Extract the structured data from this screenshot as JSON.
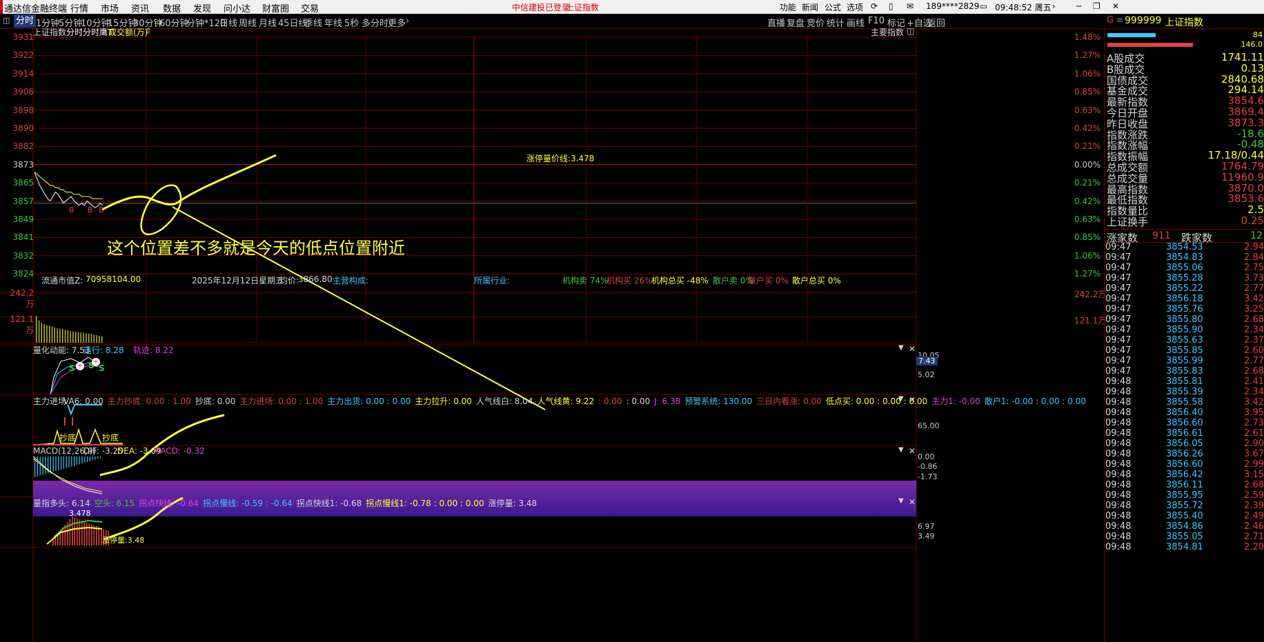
{
  "menubar": {
    "app_title": "通达信金融终端",
    "menus": [
      "行情",
      "市场",
      "资讯",
      "数据",
      "发现",
      "问小达",
      "财富圈",
      "交易"
    ],
    "login_status": "中信建投已登录",
    "index_name": "上证指数",
    "right_items": [
      "功能",
      "新闻",
      "公式",
      "选项"
    ],
    "account": "189****2829",
    "clock": "09:48:52 周五"
  },
  "tabs": {
    "items": [
      "分时",
      "1分钟",
      "5分钟",
      "10分钟",
      "15分钟",
      "30分钟",
      "60分钟",
      "分钟*120",
      "日线",
      "周线",
      "月线",
      "45日线",
      "季线",
      "年线",
      "5秒",
      "多分时",
      "更多"
    ],
    "active": "分时",
    "right": [
      "直播",
      "复盘",
      "竞价",
      "统计",
      "画线",
      "F10",
      "标记",
      "+自选",
      "返回"
    ]
  },
  "chart_header": {
    "title": "上证指数",
    "mode1": "分时",
    "mode2": "分时鹰T",
    "mode3": "成交额(万)",
    "main_indicator": "主要指数"
  },
  "chart_data": {
    "type": "line",
    "y_labels": [
      "3931",
      "3922",
      "3914",
      "3906",
      "3898",
      "3890",
      "3882",
      "3873",
      "3865",
      "3857",
      "3849",
      "3841",
      "3832",
      "3824"
    ],
    "pct_labels": [
      "1.48%",
      "1.27%",
      "1.06%",
      "0.85%",
      "0.63%",
      "0.42%",
      "0.21%",
      "0.00%",
      "0.21%",
      "0.42%",
      "0.63%",
      "0.85%",
      "1.06%",
      "1.27%"
    ],
    "ylim": [
      3824,
      3931
    ],
    "prev_close": 3873.3,
    "price_series": [
      3870,
      3867,
      3864,
      3862,
      3860,
      3858,
      3857,
      3859,
      3861,
      3860,
      3858,
      3856,
      3857,
      3858,
      3859,
      3857,
      3856,
      3855,
      3856,
      3855,
      3857,
      3856,
      3855,
      3854,
      3854.5,
      3856,
      3855
    ],
    "avg_series": [
      3870,
      3869,
      3868,
      3867,
      3866,
      3865,
      3864,
      3864,
      3863,
      3863,
      3862,
      3862,
      3861,
      3861,
      3861,
      3860,
      3860,
      3860,
      3859,
      3859,
      3859,
      3859,
      3858,
      3858,
      3858,
      3858,
      3858
    ],
    "volume_labels": [
      "242.2万",
      "121.1万"
    ],
    "volume_bars": [
      230,
      190,
      170,
      160,
      150,
      145,
      140,
      130,
      125,
      120,
      118,
      110,
      108,
      100,
      95,
      92,
      90,
      88,
      85,
      80,
      78,
      75,
      70,
      65,
      60,
      55
    ],
    "limit_line_label": "涨停量价线:3.478"
  },
  "info_bar": {
    "mcap_label": "流通市值Z:",
    "mcap_value": "70958104.00",
    "date": "2025年12月12日星期五",
    "avg_label": "均价:",
    "avg_value": "3866.80",
    "main_label": "主营构成:",
    "industry_label": "所属行业:",
    "inst_sell": "机构卖 74%",
    "inst_buy": "机构买 26%",
    "inst_total": "机构总买 -48%",
    "retail_sell": "散户卖 0%",
    "retail_buy": "散户买 0%",
    "retail_total": "散户总买 0%"
  },
  "annotation_text": "这个位置差不多就是今天的低点位置附近",
  "panel1": {
    "name": "量化",
    "a": "动能: 7.53",
    "b": "运行: 8.28",
    "c": "轨迹: 8.22",
    "r1": "10.05",
    "r2": "7.43",
    "r3": "5.02"
  },
  "panel2": {
    "name": "主力进场",
    "items": [
      {
        "t": "VA6: 0.00",
        "c": "#d8d8d8"
      },
      {
        "t": "主力抄底: 0.00 : 1.00",
        "c": "#e04040"
      },
      {
        "t": "抄底: 0.00",
        "c": "#d8d8d8"
      },
      {
        "t": "主力进场: 0.00 : 1.00",
        "c": "#e04040"
      },
      {
        "t": "主力出货: 0.00 : 0.00",
        "c": "#3cc8ff"
      },
      {
        "t": "主力拉升: 0.00",
        "c": "#ffff40"
      },
      {
        "t": "人气线白: 8.04",
        "c": "#d8d8d8"
      },
      {
        "t": "人气线黄: 9.22",
        "c": "#ffff40"
      },
      {
        "t": ": 0.00",
        "c": "#e04040"
      },
      {
        "t": ": 0.00",
        "c": "#d8d8d8"
      },
      {
        "t": "J: 6.38",
        "c": "#e040e0"
      },
      {
        "t": "预警系统: 130.00",
        "c": "#3cc8ff"
      },
      {
        "t": "三日内看涨: 0.00",
        "c": "#e04040"
      },
      {
        "t": "低点买: 0.00 : 0.00 : 0.00",
        "c": "#ffff40"
      },
      {
        "t": "主力1: -0.00",
        "c": "#e040e0"
      },
      {
        "t": "散户1: -0.00 : 0.00 : 0.00",
        "c": "#3cc8ff"
      }
    ],
    "r1": "65.00",
    "tag": "抄底"
  },
  "panel3": {
    "name": "MACD(12,26,9)",
    "dif": "DIF: -3.25",
    "dea": "DEA: -3.09",
    "macd": "MACD: -0.32",
    "r1": "0.00",
    "r2": "-0.86",
    "r3": "-1.73"
  },
  "panel4": {
    "name": "量指",
    "items": [
      {
        "t": "多头: 6.14",
        "c": "#d8d8d8"
      },
      {
        "t": "空头: 6.15",
        "c": "#3cc83c"
      },
      {
        "t": "拐点快线: -0.64",
        "c": "#e040e0"
      },
      {
        "t": "拐点慢线: -0.59 : -0.64",
        "c": "#3cc8ff"
      },
      {
        "t": "拐点快线1: -0.68",
        "c": "#d8d8d8"
      },
      {
        "t": "拐点慢线1: -0.78 : 0.00 : 0.00",
        "c": "#ffff40"
      },
      {
        "t": "涨停量: 3.48",
        "c": "#d8d8d8"
      }
    ],
    "peak": "3.478",
    "limit": "涨停量:3.48",
    "r1": "6.97",
    "r2": "3.49"
  },
  "right_panel": {
    "code": "999999",
    "name": "上证指数",
    "small_vals": [
      "84",
      "146.0"
    ],
    "stats": [
      {
        "k": "A股成交",
        "v": "1741.11"
      },
      {
        "k": "B股成交",
        "v": "0.13"
      },
      {
        "k": "国债成交",
        "v": "2840.68"
      },
      {
        "k": "基金成交",
        "v": "294.14"
      },
      {
        "k": "最新指数",
        "v": "3854.6"
      },
      {
        "k": "今日开盘",
        "v": "3869.4"
      },
      {
        "k": "昨日收盘",
        "v": "3873.3"
      },
      {
        "k": "指数涨跌",
        "v": "-18.6"
      },
      {
        "k": "指数涨幅",
        "v": "-0.48"
      },
      {
        "k": "指数振幅",
        "v": "17.18/0.44"
      },
      {
        "k": "总成交额",
        "v": "1764.79"
      },
      {
        "k": "总成交量",
        "v": "11960.9"
      },
      {
        "k": "最高指数",
        "v": "3870.0"
      },
      {
        "k": "最低指数",
        "v": "3853.6"
      },
      {
        "k": "指数量比",
        "v": "2.5"
      },
      {
        "k": "上证换手",
        "v": "0.25"
      }
    ],
    "up_label": "涨家数",
    "up_count": "911",
    "down_label": "跌家数",
    "down_count": "12",
    "ticks": [
      [
        "09:47",
        "3854.53",
        "2.94"
      ],
      [
        "09:47",
        "3854.83",
        "2.84"
      ],
      [
        "09:47",
        "3855.06",
        "2.75"
      ],
      [
        "09:47",
        "3855.28",
        "3.73"
      ],
      [
        "09:47",
        "3855.22",
        "2.77"
      ],
      [
        "09:47",
        "3856.18",
        "3.42"
      ],
      [
        "09:47",
        "3855.76",
        "3.25"
      ],
      [
        "09:47",
        "3855.80",
        "2.68"
      ],
      [
        "09:47",
        "3855.90",
        "2.34"
      ],
      [
        "09:47",
        "3855.63",
        "2.37"
      ],
      [
        "09:47",
        "3855.85",
        "2.60"
      ],
      [
        "09:47",
        "3855.99",
        "2.77"
      ],
      [
        "09:47",
        "3855.83",
        "2.68"
      ],
      [
        "09:48",
        "3855.81",
        "2.41"
      ],
      [
        "09:48",
        "3855.39",
        "2.34"
      ],
      [
        "09:48",
        "3855.58",
        "3.42"
      ],
      [
        "09:48",
        "3856.40",
        "3.95"
      ],
      [
        "09:48",
        "3856.60",
        "2.73"
      ],
      [
        "09:48",
        "3856.61",
        "2.61"
      ],
      [
        "09:48",
        "3856.05",
        "2.90"
      ],
      [
        "09:48",
        "3856.26",
        "3.67"
      ],
      [
        "09:48",
        "3856.60",
        "2.99"
      ],
      [
        "09:48",
        "3856.42",
        "3.15"
      ],
      [
        "09:48",
        "3856.11",
        "2.68"
      ],
      [
        "09:48",
        "3855.95",
        "2.59"
      ],
      [
        "09:48",
        "3855.72",
        "2.39"
      ],
      [
        "09:48",
        "3855.40",
        "2.49"
      ],
      [
        "09:48",
        "3854.86",
        "2.46"
      ],
      [
        "09:48",
        "3855.05",
        "2.71"
      ],
      [
        "09:48",
        "3854.81",
        "2.20"
      ]
    ]
  }
}
